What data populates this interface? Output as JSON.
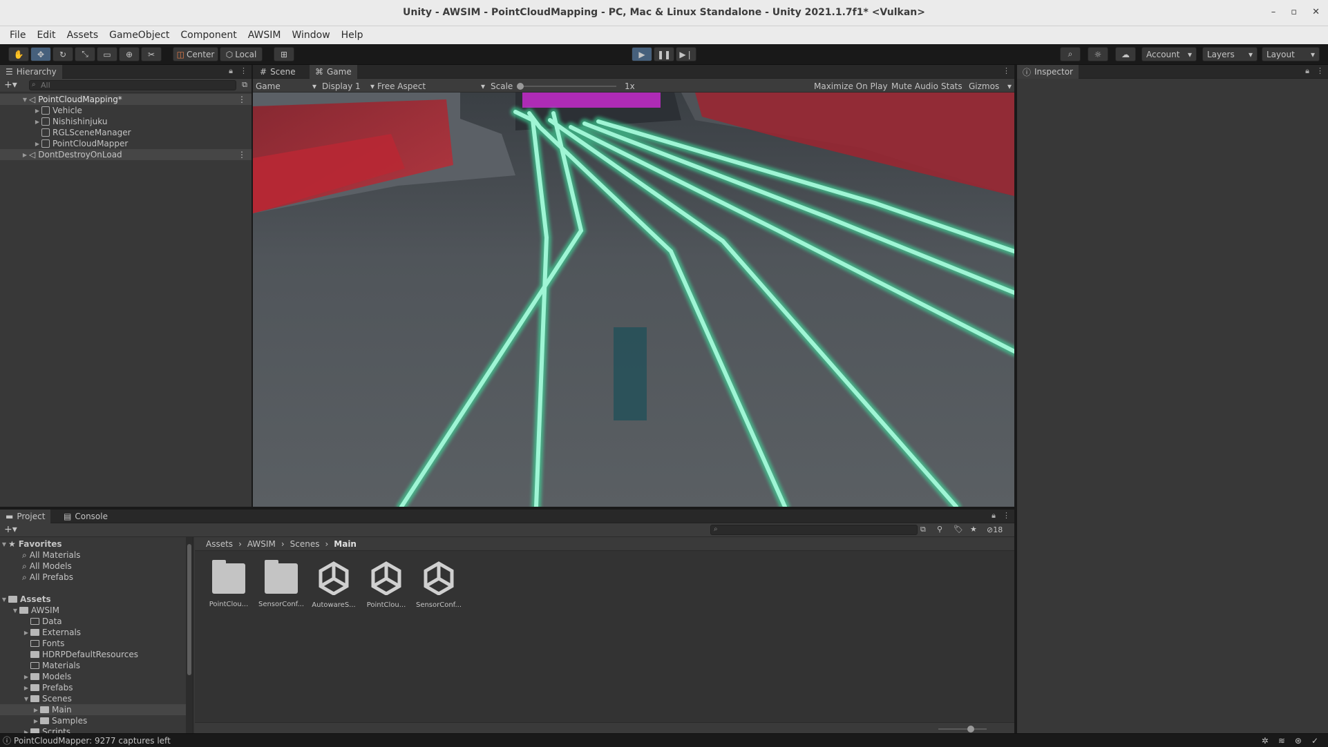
{
  "window": {
    "title": "Unity - AWSIM - PointCloudMapping - PC, Mac & Linux Standalone - Unity 2021.1.7f1* <Vulkan>",
    "minimize": "–",
    "restore": "▫",
    "close": "✕"
  },
  "menu": [
    "File",
    "Edit",
    "Assets",
    "GameObject",
    "Component",
    "AWSIM",
    "Window",
    "Help"
  ],
  "toolbar": {
    "center": "Center",
    "local": "Local",
    "account": "Account",
    "layers": "Layers",
    "layout": "Layout"
  },
  "hierarchy": {
    "tab": "Hierarchy",
    "search_placeholder": "All",
    "scene": "PointCloudMapping*",
    "items": [
      "Vehicle",
      "Nishishinjuku",
      "RGLSceneManager",
      "PointCloudMapper"
    ],
    "dont_destroy": "DontDestroyOnLoad"
  },
  "game": {
    "tab_scene": "Scene",
    "tab_game": "Game",
    "display_mode": "Game",
    "display": "Display 1",
    "aspect": "Free Aspect",
    "scale_label": "Scale",
    "scale_value": "1x",
    "maximize": "Maximize On Play",
    "mute": "Mute Audio",
    "stats": "Stats",
    "gizmos": "Gizmos"
  },
  "inspector": {
    "tab": "Inspector"
  },
  "project": {
    "tab_project": "Project",
    "tab_console": "Console",
    "favorites_label": "Favorites",
    "favorites": [
      "All Materials",
      "All Models",
      "All Prefabs"
    ],
    "assets_label": "Assets",
    "tree": [
      {
        "label": "AWSIM"
      },
      {
        "label": "Data"
      },
      {
        "label": "Externals"
      },
      {
        "label": "Fonts"
      },
      {
        "label": "HDRPDefaultResources"
      },
      {
        "label": "Materials"
      },
      {
        "label": "Models"
      },
      {
        "label": "Prefabs"
      },
      {
        "label": "Scenes"
      },
      {
        "label": "Main"
      },
      {
        "label": "Samples"
      },
      {
        "label": "Scripts"
      }
    ],
    "breadcrumb": [
      "Assets",
      "AWSIM",
      "Scenes",
      "Main"
    ],
    "hidden_count": "18",
    "assets": [
      {
        "label": "PointClou...",
        "kind": "folder"
      },
      {
        "label": "SensorConf...",
        "kind": "folder"
      },
      {
        "label": "AutowareS...",
        "kind": "unity"
      },
      {
        "label": "PointClou...",
        "kind": "unity"
      },
      {
        "label": "SensorConf...",
        "kind": "unity"
      }
    ]
  },
  "status": {
    "message": "PointCloudMapper: 9277 captures left"
  },
  "colors": {
    "accent_blue": "#46607c",
    "lane_glow": "#7cf3c4",
    "points_red": "#c02a35",
    "points_magenta": "#e02ee0"
  }
}
